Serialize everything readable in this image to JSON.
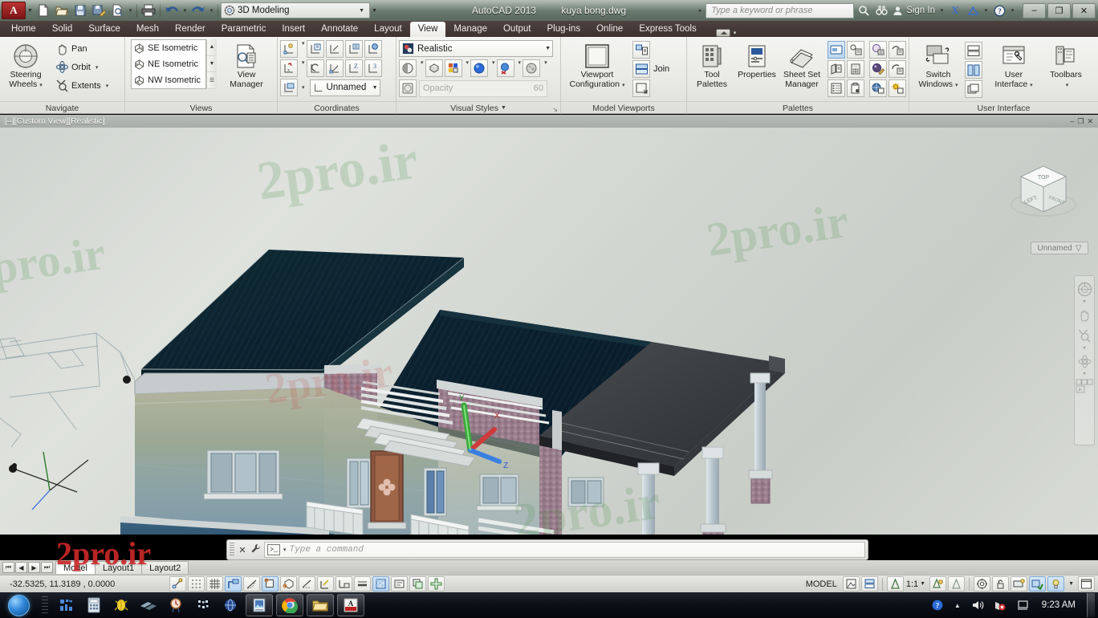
{
  "titlebar": {
    "app_logo": "autocad-logo",
    "workspace": "3D Modeling",
    "app_name": "AutoCAD 2013",
    "document": "kuya bong.dwg",
    "search_placeholder": "Type a keyword or phrase",
    "signin": "Sign In",
    "quick_access": [
      {
        "name": "new-file-icon",
        "label": "New"
      },
      {
        "name": "open-file-icon",
        "label": "Open"
      },
      {
        "name": "save-icon",
        "label": "Save"
      },
      {
        "name": "save-as-icon",
        "label": "Save As"
      },
      {
        "name": "plot-preview-icon",
        "label": "Plot Preview"
      },
      {
        "name": "print-icon",
        "label": "Plot"
      },
      {
        "name": "undo-icon",
        "label": "Undo"
      },
      {
        "name": "redo-icon",
        "label": "Redo"
      }
    ],
    "window_buttons": [
      {
        "name": "minimize-button",
        "glyph": "–"
      },
      {
        "name": "restore-button",
        "glyph": "❐"
      },
      {
        "name": "close-button",
        "glyph": "✕"
      }
    ]
  },
  "menu": {
    "tabs": [
      "Home",
      "Solid",
      "Surface",
      "Mesh",
      "Render",
      "Parametric",
      "Insert",
      "Annotate",
      "Layout",
      "View",
      "Manage",
      "Output",
      "Plug-ins",
      "Online",
      "Express Tools"
    ],
    "active": "View"
  },
  "ribbon": {
    "panels": [
      {
        "title": "Navigate",
        "big_button": {
          "label_line1": "Steering",
          "label_line2": "Wheels",
          "icon": "steering-wheel-icon"
        },
        "items": [
          {
            "label": "Pan",
            "icon": "pan-hand-icon",
            "dropdown": false
          },
          {
            "label": "Orbit",
            "icon": "orbit-icon",
            "dropdown": true
          },
          {
            "label": "Extents",
            "icon": "zoom-extents-icon",
            "dropdown": true
          }
        ]
      },
      {
        "title": "Views",
        "list": [
          "SE Isometric",
          "NE Isometric",
          "NW Isometric"
        ],
        "big_button": {
          "label_line1": "View",
          "label_line2": "Manager",
          "icon": "view-manager-icon"
        }
      },
      {
        "title": "Coordinates",
        "ucs_combo": "Unnamed",
        "icons": [
          "ucs-named-icon",
          "ucs-world-icon",
          "ucs-face-icon",
          "ucs-object-icon",
          "ucs-view-icon",
          "ucs-origin-icon",
          "ucs-previous-icon",
          "ucs-3point-icon",
          "ucs-z-axis-icon",
          "ucs-3d-icon",
          "ucs-display-icon"
        ]
      },
      {
        "title": "Visual Styles",
        "style": "Realistic",
        "opacity_label": "Opacity",
        "opacity_value": "60",
        "icons": [
          "visual-style-shadow-icon",
          "visual-style-face-icon",
          "visual-style-color-icon",
          "visual-style-material-icon",
          "visual-style-texture-off-icon",
          "visual-style-xray-icon"
        ]
      },
      {
        "title": "Model Viewports",
        "big_button": {
          "label_line1": "Viewport",
          "label_line2": "Configuration",
          "icon": "viewport-config-icon"
        },
        "items": [
          {
            "label": "",
            "icon": "viewport-named-icon"
          },
          {
            "label": "Join",
            "icon": "viewport-join-icon"
          },
          {
            "label": "",
            "icon": "viewport-restore-icon"
          }
        ]
      },
      {
        "title": "Palettes",
        "big_buttons": [
          {
            "label_line1": "Tool",
            "label_line2": "Palettes",
            "icon": "tool-palettes-icon"
          },
          {
            "label_line1": "Properties",
            "label_line2": "",
            "icon": "properties-icon"
          },
          {
            "label_line1": "Sheet Set",
            "label_line2": "Manager",
            "icon": "sheet-set-manager-icon"
          }
        ],
        "icons": [
          "palette-layer-icon",
          "palette-dbconnect-icon",
          "palette-markup-icon",
          "palette-quickcalc-icon",
          "palette-designcenter-icon",
          "palette-external-refs-icon",
          "palette-materials-icon",
          "palette-visual-styles-icon",
          "palette-materials-edit-icon",
          "palette-render-settings-icon",
          "palette-advanced-render-icon",
          "palette-sun-properties-icon"
        ]
      },
      {
        "title": "User Interface",
        "big_buttons": [
          {
            "label_line1": "Switch",
            "label_line2": "Windows",
            "icon": "switch-windows-icon"
          },
          {
            "label_line1": "User",
            "label_line2": "Interface",
            "icon": "user-interface-icon"
          },
          {
            "label_line1": "Toolbars",
            "label_line2": "",
            "icon": "toolbars-icon"
          }
        ],
        "icons": [
          "tile-horizontally-icon",
          "tile-vertically-icon",
          "cascade-icon"
        ]
      }
    ]
  },
  "viewport": {
    "label": "[–][Custom View][Realistic]",
    "window_buttons": [
      {
        "name": "viewport-minimize",
        "glyph": "–"
      },
      {
        "name": "viewport-maximize",
        "glyph": "❐"
      },
      {
        "name": "viewport-close",
        "glyph": "✕"
      }
    ],
    "viewcube": {
      "faces": [
        "TOP",
        "FRONT",
        "LEFT"
      ],
      "combo_label": "Unnamed"
    },
    "nav_bar_icons": [
      "steering-wheel-icon",
      "pan-hand-icon",
      "zoom-icon",
      "orbit-icon",
      "showmotion-icon"
    ],
    "ucs_axes": [
      "X",
      "Y",
      "Z"
    ],
    "watermarks": [
      "2pro.ir"
    ]
  },
  "command_line": {
    "placeholder": "Type a command",
    "close_glyph": "✕",
    "settings_icon": "wrench-icon",
    "prompt_icon": "command-prompt-icon"
  },
  "layout_tabs": {
    "nav_buttons": [
      "⏮",
      "◀",
      "▶",
      "⏭"
    ],
    "tabs": [
      "Model",
      "Layout1",
      "Layout2"
    ],
    "active": "Model",
    "watermark": "2pro.ir"
  },
  "status_bar": {
    "coordinates": "-32.5325, 11.3189 , 0.0000",
    "left_toggles": [
      {
        "name": "infer-constraints-icon",
        "on": false
      },
      {
        "name": "snap-mode-icon",
        "on": false
      },
      {
        "name": "grid-display-icon",
        "on": false
      },
      {
        "name": "ortho-mode-icon",
        "on": true
      },
      {
        "name": "polar-tracking-icon",
        "on": false
      },
      {
        "name": "object-snap-icon",
        "on": true
      },
      {
        "name": "3d-object-snap-icon",
        "on": false
      },
      {
        "name": "object-snap-tracking-icon",
        "on": false
      },
      {
        "name": "dynamic-ucs-icon",
        "on": false
      },
      {
        "name": "dynamic-input-icon",
        "on": false
      },
      {
        "name": "lineweight-icon",
        "on": false
      },
      {
        "name": "transparency-icon",
        "on": true
      },
      {
        "name": "quick-properties-icon",
        "on": false
      },
      {
        "name": "selection-cycling-icon",
        "on": false
      },
      {
        "name": "annotation-monitor-icon",
        "on": false
      }
    ],
    "model_label": "MODEL",
    "scale": "1:1",
    "right_icons": [
      "model-space-icon",
      "quick-view-layouts-icon",
      "annotation-scale-icon",
      "annotation-visibility-icon",
      "auto-scale-icon",
      "workspace-switching-icon",
      "lock-toolbars-icon",
      "hardware-acceleration-icon",
      "isolate-objects-icon",
      "status-bar-menu-icon",
      "clean-screen-icon"
    ]
  },
  "taskbar": {
    "start": "start-orb-icon",
    "pinned": [
      "network-monitor-icon",
      "calculator-icon",
      "antivirus-icon",
      "media-player-icon",
      "clock-tool-icon",
      "bluetooth-icon",
      "browser-icon"
    ],
    "windows": [
      "image-viewer-icon",
      "chrome-icon",
      "file-explorer-icon",
      "autocad-icon"
    ],
    "tray": [
      "action-center-icon",
      "show-hidden-icon",
      "volume-icon",
      "network-error-icon",
      "display-icon"
    ],
    "clock": "9:23 AM"
  }
}
